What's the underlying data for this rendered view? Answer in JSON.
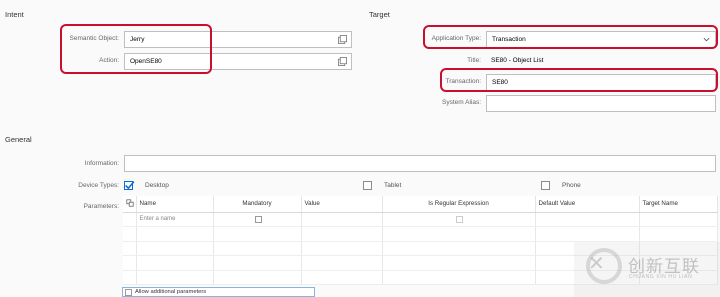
{
  "intent": {
    "section_title": "Intent",
    "semantic_object": {
      "label": "Semantic Object:",
      "value": "Jerry"
    },
    "action": {
      "label": "Action:",
      "value": "OpenSE80"
    }
  },
  "target": {
    "section_title": "Target",
    "application_type": {
      "label": "Application Type:",
      "value": "Transaction"
    },
    "title": {
      "label": "Title:",
      "value": "SE80 - Object List"
    },
    "transaction": {
      "label": "Transaction:",
      "value": "SE80"
    },
    "system_alias": {
      "label": "System Alias:",
      "value": ""
    }
  },
  "general": {
    "section_title": "General",
    "information": {
      "label": "Information:",
      "value": ""
    },
    "device_types": {
      "label": "Device Types:",
      "desktop": {
        "label": "Desktop",
        "checked": true
      },
      "tablet": {
        "label": "Tablet",
        "checked": false
      },
      "phone": {
        "label": "Phone",
        "checked": false
      }
    },
    "parameters": {
      "label": "Parameters:",
      "columns": [
        "Name",
        "Mandatory",
        "Value",
        "Is Regular Expression",
        "Default Value",
        "Target Name"
      ],
      "first_row_placeholder": "Enter a name"
    },
    "allow_additional_parameters": {
      "label": "Allow additional parameters",
      "checked": false
    }
  },
  "watermark": {
    "text": "创新互联",
    "sub": "CHUANG XIN HU LIAN"
  },
  "colors": {
    "highlight": "#c8102e",
    "checkbox_accent": "#0a6ed1"
  }
}
